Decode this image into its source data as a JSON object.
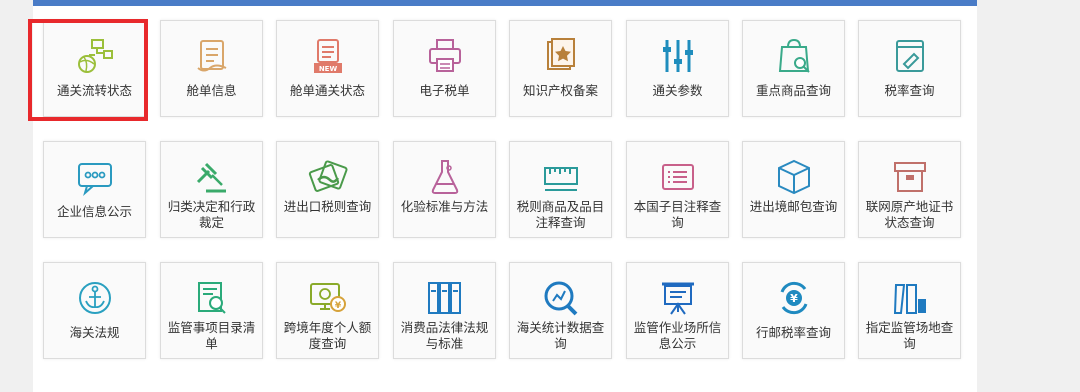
{
  "colors": {
    "top_bar": "#4a7cc7",
    "selection_border": "#e8292c",
    "tile_border": "#dcdcdc",
    "label_text": "#333333"
  },
  "tiles": [
    {
      "label": "通关流转状态",
      "icon": "flow-network-icon",
      "color": "#9bbf3a"
    },
    {
      "label": "舱单信息",
      "icon": "manifest-paper-icon",
      "color": "#d9a66a"
    },
    {
      "label": "舱单通关状态",
      "icon": "manifest-new-icon",
      "color": "#e07a6a"
    },
    {
      "label": "电子税单",
      "icon": "printer-icon",
      "color": "#b8629a"
    },
    {
      "label": "知识产权备案",
      "icon": "certificate-star-icon",
      "color": "#b8803a"
    },
    {
      "label": "通关参数",
      "icon": "sliders-icon",
      "color": "#1f8dbd"
    },
    {
      "label": "重点商品查询",
      "icon": "bag-search-icon",
      "color": "#3aaa8a"
    },
    {
      "label": "税率查询",
      "icon": "book-tag-icon",
      "color": "#3a9a9a"
    },
    {
      "label": "企业信息公示",
      "icon": "chat-bubble-icon",
      "color": "#2a9ac0"
    },
    {
      "label": "归类决定和行政裁定",
      "icon": "gavel-icon",
      "color": "#3aaa6a"
    },
    {
      "label": "进出口税则查询",
      "icon": "handshake-icon",
      "color": "#4a9a4a"
    },
    {
      "label": "化验标准与方法",
      "icon": "flask-icon",
      "color": "#b8629a"
    },
    {
      "label": "税则商品及品目注释查询",
      "icon": "ruler-icon",
      "color": "#2a9a9a"
    },
    {
      "label": "本国子目注释查询",
      "icon": "list-card-icon",
      "color": "#c8608a"
    },
    {
      "label": "进出境邮包查询",
      "icon": "package-box-icon",
      "color": "#2a8ac0"
    },
    {
      "label": "联网原产地证书状态查询",
      "icon": "archive-box-icon",
      "color": "#c0706a"
    },
    {
      "label": "海关法规",
      "icon": "anchor-icon",
      "color": "#2aa0c0"
    },
    {
      "label": "监管事项目录清单",
      "icon": "doc-search-icon",
      "color": "#2aaa7a"
    },
    {
      "label": "跨境年度个人额度查询",
      "icon": "monitor-yen-icon",
      "color": "#8aaa2a"
    },
    {
      "label": "消费品法律法规与标准",
      "icon": "binders-icon",
      "color": "#1f7ac0"
    },
    {
      "label": "海关统计数据查询",
      "icon": "search-stats-icon",
      "color": "#1f7ac0"
    },
    {
      "label": "监管作业场所信息公示",
      "icon": "easel-board-icon",
      "color": "#1f6ac0"
    },
    {
      "label": "行邮税率查询",
      "icon": "yen-cycle-icon",
      "color": "#1f8ac0"
    },
    {
      "label": "指定监管场地查询",
      "icon": "blocks-icon",
      "color": "#1f7ac0"
    }
  ],
  "selected_index": 0
}
